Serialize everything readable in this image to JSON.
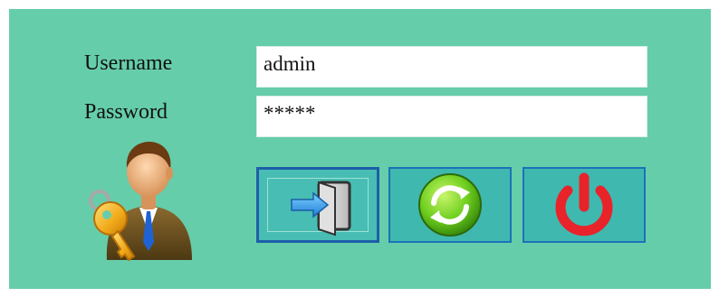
{
  "form": {
    "username_label": "Username",
    "password_label": "Password",
    "username_value": "admin",
    "password_value": "*****"
  },
  "buttons": {
    "login_icon": "login-door-arrow-icon",
    "refresh_icon": "refresh-icon",
    "exit_icon": "power-icon"
  },
  "avatar_icon": "user-with-key-icon",
  "colors": {
    "background": "#66cdaa",
    "button_fill": "#3fb8af",
    "button_border": "#1d72b8",
    "refresh_green": "#6fcf1f",
    "power_red": "#e8232a"
  }
}
